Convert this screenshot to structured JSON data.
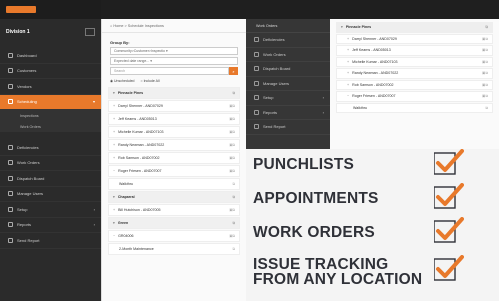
{
  "app": {
    "division": "Division 1"
  },
  "sidebar": {
    "items": [
      {
        "label": "Dashboard",
        "icon": "dashboard-icon"
      },
      {
        "label": "Customers",
        "icon": "customers-icon"
      },
      {
        "label": "Vendors",
        "icon": "vendors-icon"
      },
      {
        "label": "Scheduling",
        "icon": "calendar-icon",
        "active": true
      }
    ],
    "subitems": [
      "Inspections",
      "Work Orders"
    ],
    "items2": [
      {
        "label": "Deficiencies"
      },
      {
        "label": "Work Orders"
      },
      {
        "label": "Dispatch Board"
      },
      {
        "label": "Manage Users"
      },
      {
        "label": "Setup"
      },
      {
        "label": "Reports"
      },
      {
        "label": "Send Report"
      }
    ]
  },
  "main": {
    "breadcrumb": "⌂ Home > Schedule Inspections",
    "group_by_label": "Group By:",
    "group_by_value": "Community>Customer>Inspectio ▾",
    "date_range": "Expected date range... ▾",
    "search_placeholder": "Search",
    "radio_unscheduled": "Unscheduled",
    "radio_include_all": "Include All",
    "tree": [
      {
        "type": "group",
        "label": "Pinnacle Pines"
      },
      {
        "type": "leaf",
        "label": "Darryl Shenner - AND07029"
      },
      {
        "type": "leaf",
        "label": "Jeff Kearns - AND05013"
      },
      {
        "type": "leaf",
        "label": "Michelle Kumar - AND07103"
      },
      {
        "type": "leaf",
        "label": "Randy Newman - AND07022"
      },
      {
        "type": "leaf",
        "label": "Rob Samson - AND07002"
      },
      {
        "type": "leaf",
        "label": "Roger Friesen - AND07007"
      },
      {
        "type": "sub",
        "label": "Walkthru"
      },
      {
        "type": "group",
        "label": "Chaparral"
      },
      {
        "type": "leaf",
        "label": "Bill Hutchison - AND07005"
      },
      {
        "type": "group",
        "label": "Green"
      },
      {
        "type": "leaf",
        "label": "GR04006"
      },
      {
        "type": "sub",
        "label": "2-Month Maintenance"
      }
    ]
  },
  "overlay_sidebar": {
    "header": "Work Orders",
    "items": [
      "Deficiencies",
      "Work Orders",
      "Dispatch Board",
      "Manage Users",
      "Setup",
      "Reports",
      "Send Report"
    ]
  },
  "right_tree": [
    {
      "type": "group",
      "label": "Pinnacle Pines"
    },
    {
      "type": "leaf",
      "label": "Darryl Shenner - AND07029"
    },
    {
      "type": "leaf",
      "label": "Jeff Kearns - AND05013"
    },
    {
      "type": "leaf",
      "label": "Michelle Kumar - AND07103"
    },
    {
      "type": "leaf",
      "label": "Randy Newman - AND07022"
    },
    {
      "type": "leaf",
      "label": "Rob Samson - AND07002"
    },
    {
      "type": "leaf",
      "label": "Roger Friesen - AND07007"
    },
    {
      "type": "sub",
      "label": "Walkthru"
    }
  ],
  "features": [
    {
      "line1": "PUNCHLISTS"
    },
    {
      "line1": "APPOINTMENTS"
    },
    {
      "line1": "WORK ORDERS"
    },
    {
      "line1": "ISSUE TRACKING",
      "line2": "FROM ANY LOCATION"
    }
  ],
  "colors": {
    "accent": "#e8792b",
    "sidebar_bg": "#2b2b2b",
    "feature_text": "#2f3138"
  }
}
